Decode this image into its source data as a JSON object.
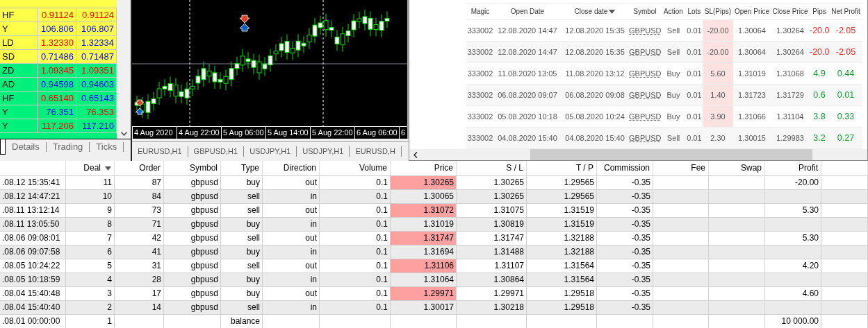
{
  "market_watch": {
    "rows": [
      {
        "symbol": "HF",
        "bid": {
          "text": "0.91124",
          "color": "#ff0000"
        },
        "ask": {
          "text": "0.91124",
          "color": "#ff0000"
        },
        "color": "#ffff4a"
      },
      {
        "symbol": "Y",
        "bid": {
          "text": "106.806",
          "color": "#0000ff"
        },
        "ask": {
          "text": "106.807",
          "color": "#0000ff"
        },
        "color": "#ffff4a"
      },
      {
        "symbol": "LD",
        "bid": {
          "text": "1.32330",
          "color": "#ff0000"
        },
        "ask": {
          "text": "1.32334",
          "color": "#0000ff"
        },
        "color": "#ffff4a"
      },
      {
        "symbol": "SD",
        "bid": {
          "text": "0.71486",
          "color": "#0000ff"
        },
        "ask": {
          "text": "0.71487",
          "color": "#0000ff"
        },
        "color": "#ffff4a"
      },
      {
        "symbol": "ZD",
        "bid": {
          "text": "1.09345",
          "color": "#ff0000"
        },
        "ask": {
          "text": "1.09351",
          "color": "#ff0000"
        },
        "color": "#00f07c"
      },
      {
        "symbol": "AD",
        "bid": {
          "text": "0.94598",
          "color": "#0000ff"
        },
        "ask": {
          "text": "0.94603",
          "color": "#0000ff"
        },
        "color": "#00f07c"
      },
      {
        "symbol": "HF",
        "bid": {
          "text": "0.65140",
          "color": "#ff0000"
        },
        "ask": {
          "text": "0.65143",
          "color": "#0000ff"
        },
        "color": "#00f07c"
      },
      {
        "symbol": "Y",
        "bid": {
          "text": "76.351",
          "color": "#0000ff"
        },
        "ask": {
          "text": "76.353",
          "color": "#ff0000"
        },
        "color": "#00f07c"
      },
      {
        "symbol": "Y",
        "bid": {
          "text": "117.206",
          "color": "#ff0000"
        },
        "ask": {
          "text": "117.210",
          "color": "#0000ff"
        },
        "color": "#00f07c"
      }
    ],
    "tabs": [
      {
        "label": "Details",
        "selected": false
      },
      {
        "label": "Trading",
        "selected": false
      },
      {
        "label": "Ticks",
        "selected": false
      }
    ]
  },
  "chart": {
    "axis_labels": [
      "4 Aug 2020",
      "4 Aug 22:00",
      "5 Aug 06:00",
      "5 Aug 14:00",
      "5 Aug 22:00",
      "6 Aug 06:00",
      "6"
    ],
    "tabs": [
      {
        "label": "EURUSD,H1",
        "selected": false
      },
      {
        "label": "GBPUSD,H1",
        "selected": false
      },
      {
        "label": "USDJPY,H1",
        "selected": false
      },
      {
        "label": "USDJPY,H1",
        "selected": false
      },
      {
        "label": "EURUSD,H",
        "selected": false
      }
    ]
  },
  "trades_table": {
    "columns": [
      {
        "label": "Magic",
        "sorted": false
      },
      {
        "label": "Open Date",
        "sorted": false
      },
      {
        "label": "Close date",
        "sorted": true
      },
      {
        "label": "Symbol",
        "sorted": false
      },
      {
        "label": "Action",
        "sorted": false
      },
      {
        "label": "Lots",
        "sorted": false
      },
      {
        "label": "SL(Pips)",
        "sorted": false
      },
      {
        "label": "Open Price",
        "sorted": false
      },
      {
        "label": "Close Price",
        "sorted": false
      },
      {
        "label": "Pips",
        "sorted": false
      },
      {
        "label": "Net Profit",
        "sorted": false
      }
    ],
    "rows": [
      {
        "magic": "333002",
        "open_date": "12.08.2020 14:47",
        "close_date": "12.08.2020 15:35",
        "symbol": "GBPUSD",
        "action": "Sell",
        "lots": "0.01",
        "sl_pips": "-20.00",
        "sl_flag": true,
        "open_price": "1.30064",
        "close_price": "1.30264",
        "pips": {
          "text": "-20.0",
          "color": "#ff2020"
        },
        "net_profit": {
          "text": "-2.05",
          "color": "#ff2020"
        }
      },
      {
        "magic": "333002",
        "open_date": "12.08.2020 14:47",
        "close_date": "12.08.2020 15:35",
        "symbol": "GBPUSD",
        "action": "Sell",
        "lots": "0.01",
        "sl_pips": "-20.00",
        "sl_flag": true,
        "open_price": "1.30064",
        "close_price": "1.30264",
        "pips": {
          "text": "-20.0",
          "color": "#ff2020"
        },
        "net_profit": {
          "text": "-2.05",
          "color": "#ff2020"
        }
      },
      {
        "magic": "333002",
        "open_date": "11.08.2020 13:05",
        "close_date": "11.08.2020 13:12",
        "symbol": "GBPUSD",
        "action": "Buy",
        "lots": "0.01",
        "sl_pips": "5.60",
        "sl_flag": true,
        "open_price": "1.31019",
        "close_price": "1.31068",
        "pips": {
          "text": "4.9",
          "color": "#10a030"
        },
        "net_profit": {
          "text": "0.44",
          "color": "#10a030"
        }
      },
      {
        "magic": "333002",
        "open_date": "06.08.2020 09:07",
        "close_date": "06.08.2020 09:08",
        "symbol": "GBPUSD",
        "action": "Buy",
        "lots": "0.01",
        "sl_pips": "1.40",
        "sl_flag": true,
        "open_price": "1.31723",
        "close_price": "1.31729",
        "pips": {
          "text": "0.6",
          "color": "#10a030"
        },
        "net_profit": {
          "text": "0.01",
          "color": "#10a030"
        }
      },
      {
        "magic": "333002",
        "open_date": "05.08.2020 10:18",
        "close_date": "05.08.2020 10:24",
        "symbol": "GBPUSD",
        "action": "Buy",
        "lots": "0.01",
        "sl_pips": "3.90",
        "sl_flag": true,
        "open_price": "1.31066",
        "close_price": "1.31104",
        "pips": {
          "text": "3.8",
          "color": "#10a030"
        },
        "net_profit": {
          "text": "0.33",
          "color": "#10a030"
        }
      },
      {
        "magic": "333002",
        "open_date": "04.08.2020 15:40",
        "close_date": "04.08.2020 15:40",
        "symbol": "GBPUSD",
        "action": "Sell",
        "lots": "0.01",
        "sl_pips": "2.30",
        "sl_flag": false,
        "open_price": "1.30015",
        "close_price": "1.29983",
        "pips": {
          "text": "3.2",
          "color": "#10a030"
        },
        "net_profit": {
          "text": "0.27",
          "color": "#10a030"
        }
      }
    ]
  },
  "deals_table": {
    "columns": [
      {
        "label": "Deal",
        "sorted": true
      },
      {
        "label": "Order",
        "sorted": false
      },
      {
        "label": "Symbol",
        "sorted": false
      },
      {
        "label": "Type",
        "sorted": false
      },
      {
        "label": "Direction",
        "sorted": false
      },
      {
        "label": "Volume",
        "sorted": false
      },
      {
        "label": "Price",
        "sorted": false
      },
      {
        "label": "S / L",
        "sorted": false
      },
      {
        "label": "T / P",
        "sorted": false
      },
      {
        "label": "Commission",
        "sorted": false
      },
      {
        "label": "Fee",
        "sorted": false
      },
      {
        "label": "Swap",
        "sorted": false
      },
      {
        "label": "Profit",
        "sorted": false
      }
    ],
    "rows": [
      {
        "time": ".08.12 15:35:41",
        "deal": "11",
        "order": "87",
        "symbol": "gbpusd",
        "type": "buy",
        "direction": "out",
        "volume": "0.1",
        "price": "1.30265",
        "price_flag": true,
        "sl": "1.30265",
        "tp": "1.29565",
        "commission": "-0.35",
        "profit": "-20.00"
      },
      {
        "time": ".08.12 14:47:21",
        "deal": "10",
        "order": "84",
        "symbol": "gbpusd",
        "type": "sell",
        "direction": "in",
        "volume": "0.1",
        "price": "1.30065",
        "price_flag": false,
        "sl": "1.30265",
        "tp": "1.29565",
        "commission": "-0.35"
      },
      {
        "time": ".08.11 13:12:14",
        "deal": "9",
        "order": "73",
        "symbol": "gbpusd",
        "type": "sell",
        "direction": "out",
        "volume": "0.1",
        "price": "1.31072",
        "price_flag": true,
        "sl": "1.31075",
        "tp": "1.31519",
        "commission": "-0.35",
        "profit": "5.30"
      },
      {
        "time": ".08.11 13:05:50",
        "deal": "8",
        "order": "71",
        "symbol": "gbpusd",
        "type": "buy",
        "direction": "in",
        "volume": "0.1",
        "price": "1.31019",
        "price_flag": false,
        "sl": "1.30819",
        "tp": "1.31519",
        "commission": "-0.35"
      },
      {
        "time": ".08.06 09:08:01",
        "deal": "7",
        "order": "42",
        "symbol": "gbpusd",
        "type": "sell",
        "direction": "out",
        "volume": "0.1",
        "price": "1.31747",
        "price_flag": true,
        "sl": "1.31747",
        "tp": "1.32188",
        "commission": "-0.35",
        "profit": "5.30"
      },
      {
        "time": ".08.06 09:07:58",
        "deal": "6",
        "order": "41",
        "symbol": "gbpusd",
        "type": "buy",
        "direction": "in",
        "volume": "0.1",
        "price": "1.31694",
        "price_flag": false,
        "sl": "1.31488",
        "tp": "1.32188",
        "commission": "-0.35"
      },
      {
        "time": ".08.05 10:24:22",
        "deal": "5",
        "order": "31",
        "symbol": "gbpusd",
        "type": "sell",
        "direction": "out",
        "volume": "0.1",
        "price": "1.31106",
        "price_flag": true,
        "sl": "1.31107",
        "tp": "1.31564",
        "commission": "-0.35",
        "profit": "4.20"
      },
      {
        "time": ".08.05 10:18:59",
        "deal": "4",
        "order": "28",
        "symbol": "gbpusd",
        "type": "buy",
        "direction": "in",
        "volume": "0.1",
        "price": "1.31064",
        "price_flag": false,
        "sl": "1.30864",
        "tp": "1.31564",
        "commission": "-0.35"
      },
      {
        "time": ".08.04 15:40:48",
        "deal": "3",
        "order": "17",
        "symbol": "gbpusd",
        "type": "buy",
        "direction": "out",
        "volume": "0.1",
        "price": "1.29971",
        "price_flag": true,
        "sl": "1.29971",
        "tp": "1.29518",
        "commission": "-0.35",
        "profit": "4.60"
      },
      {
        "time": ".08.04 15:40:40",
        "deal": "2",
        "order": "14",
        "symbol": "gbpusd",
        "type": "sell",
        "direction": "in",
        "volume": "0.1",
        "price": "1.30017",
        "price_flag": false,
        "sl": "1.30218",
        "tp": "1.29518",
        "commission": "-0.35"
      },
      {
        "time": ".08.01 00:00:00",
        "deal": "1",
        "type": "balance",
        "profit": "10 000.00"
      }
    ]
  }
}
